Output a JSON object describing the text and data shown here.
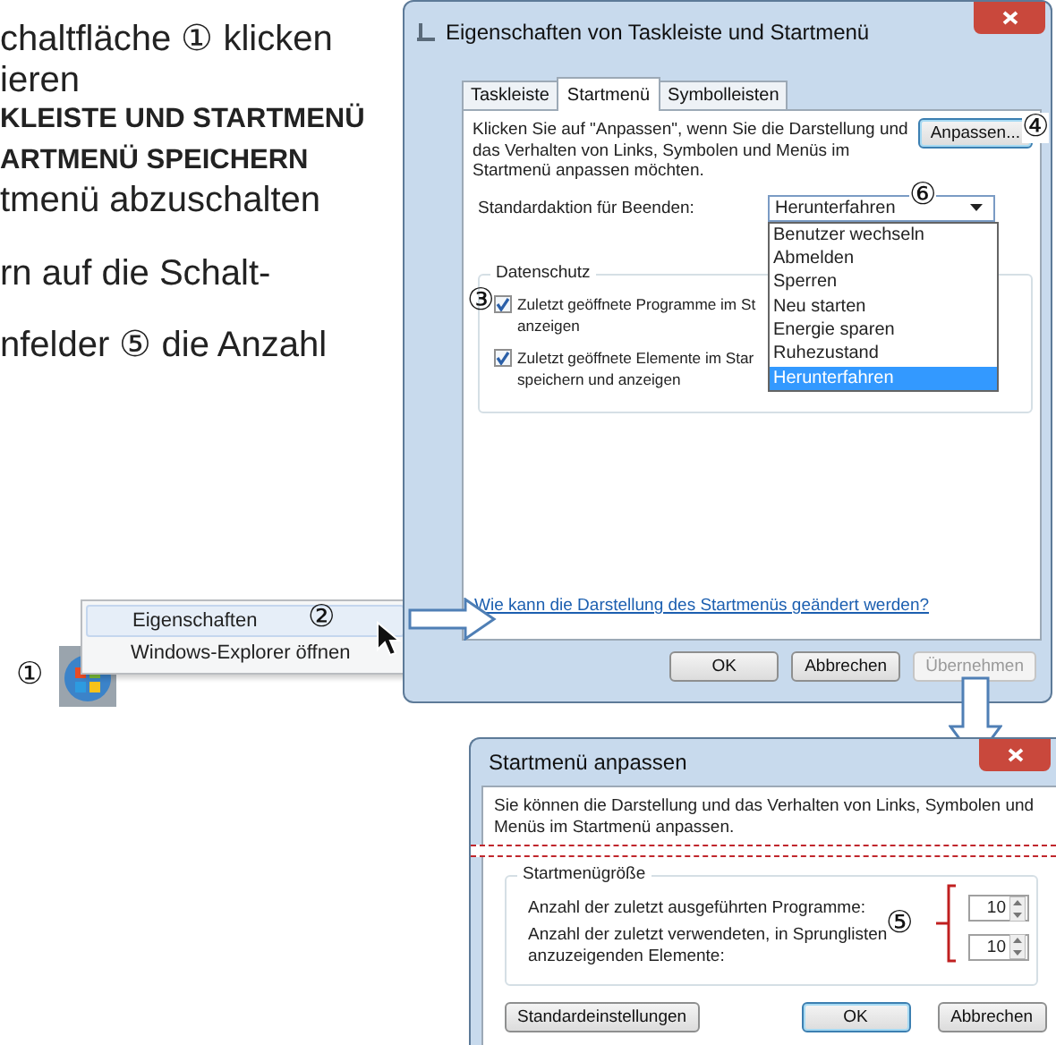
{
  "instructions": [
    {
      "lines": [
        {
          "text": "chaltfläche ① klicken",
          "bold": false
        },
        {
          "text": "ieren",
          "bold": false
        },
        {
          "text": "KLEISTE UND STARTMENÜ",
          "bold": true
        },
        {
          "text": "ARTMENÜ SPEICHERN",
          "bold": true
        },
        {
          "text": "tmenü abzuschalten",
          "bold": false
        }
      ]
    },
    {
      "lines": [
        {
          "text": "rn auf die Schalt-",
          "bold": false
        }
      ]
    },
    {
      "lines": [
        {
          "text": "nfelder ⑤ die Anzahl",
          "bold": false
        }
      ]
    }
  ],
  "start_button": {
    "callout": "①"
  },
  "context_menu": {
    "items": [
      {
        "label": "Eigenschaften",
        "selected": true,
        "callout": "②"
      },
      {
        "label": "Windows-Explorer öffnen",
        "selected": false
      }
    ]
  },
  "properties_dialog": {
    "title": "Eigenschaften von Taskleiste und Startmenü",
    "tabs": [
      {
        "label": "Taskleiste",
        "selected": false
      },
      {
        "label": "Startmenü",
        "selected": true
      },
      {
        "label": "Symbolleisten",
        "selected": false
      }
    ],
    "description": "Klicken Sie auf \"Anpassen\", wenn Sie die Darstellung und\ndas Verhalten von Links, Symbolen und Menüs im\nStartmenü anpassen möchten.",
    "customize_button": {
      "label": "Anpassen...",
      "focused": true,
      "callout": "④"
    },
    "power_action": {
      "label": "Standardaktion für Beenden:",
      "value": "Herunterfahren",
      "callout": "⑥",
      "expanded": true,
      "options": [
        {
          "label": "Benutzer wechseln",
          "selected": false
        },
        {
          "label": "Abmelden",
          "selected": false
        },
        {
          "label": "Sperren",
          "selected": false
        },
        {
          "label": "Neu starten",
          "selected": false
        },
        {
          "label": "Energie sparen",
          "selected": false
        },
        {
          "label": "Ruhezustand",
          "selected": false
        },
        {
          "label": "Herunterfahren",
          "selected": true
        }
      ]
    },
    "privacy": {
      "title": "Datenschutz",
      "checkboxes": [
        {
          "label": "Zuletzt geöffnete Programme im St\nanzeigen",
          "checked": true,
          "callout": "③"
        },
        {
          "label": "Zuletzt geöffnete Elemente im Star\nspeichern und anzeigen",
          "checked": true
        }
      ]
    },
    "help_link": "Wie kann die Darstellung des Startmenüs geändert werden?",
    "buttons": [
      {
        "label": "OK",
        "disabled": false
      },
      {
        "label": "Abbrechen",
        "disabled": false
      },
      {
        "label": "Übernehmen",
        "disabled": true
      }
    ]
  },
  "customize_dialog": {
    "title": "Startmenü anpassen",
    "description": "Sie können die Darstellung und das Verhalten von Links, Symbolen und\nMenüs im Startmenü anpassen.",
    "size_group": {
      "title": "Startmenügröße",
      "callout": "⑤",
      "rows": [
        {
          "label": "Anzahl der zuletzt ausgeführten Programme:",
          "value": "10"
        },
        {
          "label": "Anzahl der zuletzt verwendeten, in Sprunglisten\nanzuzeigenden Elemente:",
          "value": "10"
        }
      ]
    },
    "buttons": [
      {
        "label": "Standardeinstellungen",
        "focused": false
      },
      {
        "label": "OK",
        "focused": true
      },
      {
        "label": "Abbrechen",
        "focused": false
      }
    ]
  }
}
